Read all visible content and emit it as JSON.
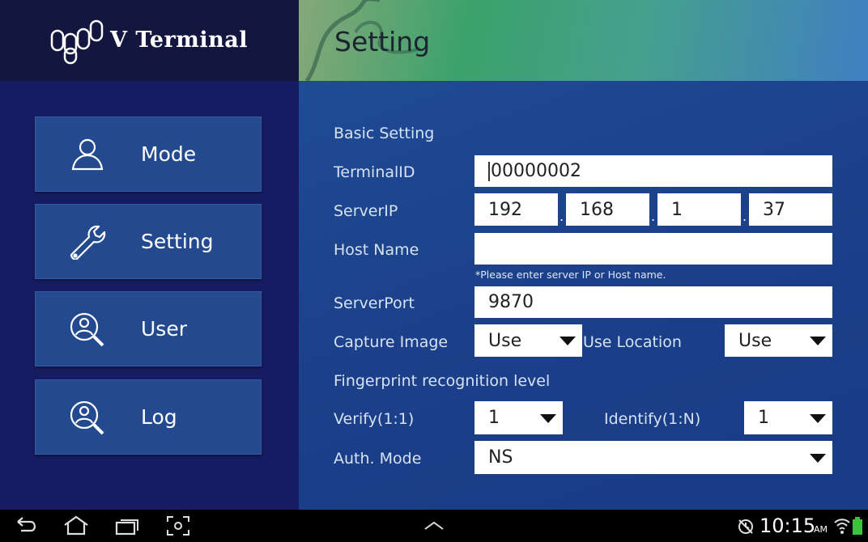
{
  "app": {
    "title": "V Terminal"
  },
  "header": {
    "title": "Setting"
  },
  "sidebar": {
    "items": [
      {
        "label": "Mode",
        "icon": "person-icon"
      },
      {
        "label": "Setting",
        "icon": "wrench-icon"
      },
      {
        "label": "User",
        "icon": "user-search-icon"
      },
      {
        "label": "Log",
        "icon": "user-search-icon"
      }
    ]
  },
  "form": {
    "section_basic": "Basic Setting",
    "terminal_id": {
      "label": "TerminalID",
      "value": "00000002"
    },
    "server_ip": {
      "label": "ServerIP",
      "octets": [
        "192",
        "168",
        "1",
        "37"
      ],
      "separator": "."
    },
    "host_name": {
      "label": "Host Name",
      "value": ""
    },
    "hint": "*Please enter server IP or Host name.",
    "server_port": {
      "label": "ServerPort",
      "value": "9870"
    },
    "capture_image": {
      "label": "Capture Image",
      "value": "Use"
    },
    "use_location": {
      "label": "Use Location",
      "value": "Use"
    },
    "section_fingerprint": "Fingerprint recognition level",
    "verify": {
      "label": "Verify(1:1)",
      "value": "1"
    },
    "identify": {
      "label": "Identify(1:N)",
      "value": "1"
    },
    "auth_mode": {
      "label": "Auth. Mode",
      "value": "NS"
    }
  },
  "statusbar": {
    "time": "10:15",
    "ampm": "AM"
  },
  "colors": {
    "sidebar": "#171c62",
    "nav_button": "#234a8f",
    "main": "#1f4b95",
    "battery": "#39c43a"
  }
}
